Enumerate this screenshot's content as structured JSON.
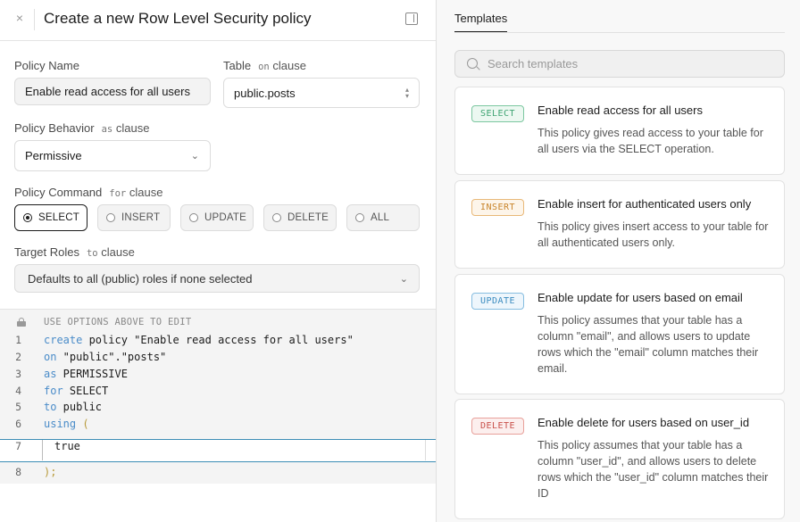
{
  "header": {
    "title": "Create a new Row Level Security policy",
    "close_glyph": "×"
  },
  "form": {
    "policy_name_label": "Policy Name",
    "policy_name_value": "Enable read access for all users",
    "table_label": "Table",
    "table_sub_keyword": "on",
    "table_sub_word": "clause",
    "table_value": "public.posts",
    "behavior_label": "Policy Behavior",
    "behavior_sub_keyword": "as",
    "behavior_sub_word": "clause",
    "behavior_value": "Permissive",
    "command_label": "Policy Command",
    "command_sub_keyword": "for",
    "command_sub_word": "clause",
    "commands": [
      "SELECT",
      "INSERT",
      "UPDATE",
      "DELETE",
      "ALL"
    ],
    "selected_command": "SELECT",
    "roles_label": "Target Roles",
    "roles_sub_keyword": "to",
    "roles_sub_word": "clause",
    "roles_value": "Defaults to all (public) roles if none selected"
  },
  "editor": {
    "hint": "USE OPTIONS ABOVE TO EDIT",
    "line_numbers": [
      "1",
      "2",
      "3",
      "4",
      "5",
      "6",
      "7",
      "8"
    ],
    "lines": [
      {
        "kw": "create",
        "rest": " policy \"Enable read access for all users\""
      },
      {
        "kw": "on",
        "rest": " \"public\".\"posts\""
      },
      {
        "kw": "as",
        "rest": " PERMISSIVE"
      },
      {
        "kw": "for",
        "rest": " SELECT"
      },
      {
        "kw": "to",
        "rest": " public"
      },
      {
        "kw": "using",
        "rest": " ("
      },
      {
        "kw": "",
        "rest": "true"
      },
      {
        "kw": "",
        "rest": ");"
      }
    ]
  },
  "templates": {
    "tab_label": "Templates",
    "search_placeholder": "Search templates",
    "cards": [
      {
        "badge": "SELECT",
        "title": "Enable read access for all users",
        "desc": "This policy gives read access to your table for all users via the SELECT operation.",
        "badge_color": "#3ea372",
        "badge_bg": "#ecf8f1",
        "badge_border": "#7cc7a0"
      },
      {
        "badge": "INSERT",
        "title": "Enable insert for authenticated users only",
        "desc": "This policy gives insert access to your table for all authenticated users only.",
        "badge_color": "#c8842a",
        "badge_bg": "#fdf5ea",
        "badge_border": "#e8b878"
      },
      {
        "badge": "UPDATE",
        "title": "Enable update for users based on email",
        "desc": "This policy assumes that your table has a column \"email\", and allows users to update rows which the \"email\" column matches their email.",
        "badge_color": "#3a8bbf",
        "badge_bg": "#eef6fc",
        "badge_border": "#86bde0"
      },
      {
        "badge": "DELETE",
        "title": "Enable delete for users based on user_id",
        "desc": "This policy assumes that your table has a column \"user_id\", and allows users to delete rows which the \"user_id\" column matches their ID",
        "badge_color": "#c8504a",
        "badge_bg": "#fcefee",
        "badge_border": "#e8a09a"
      }
    ]
  }
}
